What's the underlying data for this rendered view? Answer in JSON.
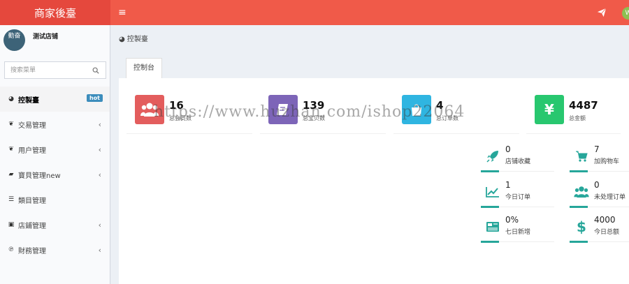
{
  "header": {
    "logo_text": "商家後臺",
    "menu_toggle": "≡",
    "user_initial": "W",
    "bg_color": "#f05a49"
  },
  "sidebar": {
    "avatar_text": "勤奋",
    "shop_name": "测试店铺",
    "search_placeholder": "搜索菜單",
    "items": [
      {
        "label": "控製臺",
        "icon": "dashboard-icon",
        "badge": "hot",
        "active": true
      },
      {
        "label": "交易管理",
        "icon": "leaf-icon",
        "chevron": "‹"
      },
      {
        "label": "用户管理",
        "icon": "leaf-icon",
        "chevron": "‹"
      },
      {
        "label": "寶貝管理new",
        "icon": "briefcase-icon",
        "chevron": "‹"
      },
      {
        "label": "類目管理",
        "icon": "list-icon"
      },
      {
        "label": "店鋪管理",
        "icon": "window-icon",
        "chevron": "‹"
      },
      {
        "label": "財務管理",
        "icon": "paypal-icon",
        "chevron": "‹"
      }
    ]
  },
  "breadcrumb": "控製臺",
  "tab": {
    "label": "控制台"
  },
  "stats": [
    {
      "value": "16",
      "label": "总会员数",
      "icon": "users-icon",
      "color": "#e35d5d"
    },
    {
      "value": "139",
      "label": "总宝贝数",
      "icon": "book-icon",
      "color": "#7d65b8"
    },
    {
      "value": "4",
      "label": "总订单数",
      "icon": "shopping-bag-icon",
      "color": "#2fb5e1"
    },
    {
      "value": "4487",
      "label": "总金额",
      "icon": "yen-icon",
      "color": "#28c76f"
    }
  ],
  "mini_stats": [
    {
      "value": "0",
      "label": "店铺收藏",
      "icon": "rocket-icon"
    },
    {
      "value": "7",
      "label": "加购物车",
      "icon": "cart-icon"
    },
    {
      "value": "1",
      "label": "今日订单",
      "icon": "line-chart-icon"
    },
    {
      "value": "0",
      "label": "未处理订单",
      "icon": "users-icon"
    },
    {
      "value": "0%",
      "label": "七日新增",
      "icon": "newspaper-icon"
    },
    {
      "value": "4000",
      "label": "今日总额",
      "icon": "dollar-icon"
    }
  ],
  "accent_color": "#26a69a",
  "watermark": "https://www.huzhan.com/ishop22064"
}
